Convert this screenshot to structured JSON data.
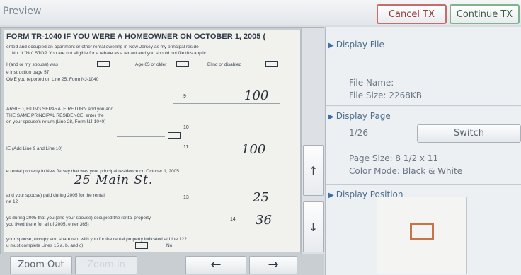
{
  "header": {
    "title": "Preview",
    "cancel_label": "Cancel TX",
    "continue_label": "Continue TX"
  },
  "document": {
    "title": "FORM TR-1040 IF YOU WERE A HOMEOWNER ON OCTOBER 1, 2005 (",
    "lines": [
      "ented and occupied an apartment or other rental dwelling in New Jersey as my principal reside",
      "No. If \"No\" STOP. You are not eligible for a rebate as a tenant and you should not file this applic",
      "I (and or my spouse) was",
      "Age 65 or older",
      "Blind or disabled",
      "e instruction page 57",
      "OME you reported on Line 25, Form NJ-1040",
      "ARRIED, FILING SEPARATE RETURN and you and",
      "THE SAME PRINCIPAL RESIDENCE, enter the",
      "on your spouse's return (Line 28, Form NJ-1040)",
      "IE (Add Line 9 and Line 10)",
      "e rental property in New Jersey that was your principal residence on October 1, 2005.",
      "and your spouse) paid during 2005 for the rental",
      "ne 12",
      "ys during 2005 that you (and your spouse) occupied the rental property",
      "you lived there for all of 2005, enter 365)",
      "your spouse, occupy and share rent with you for the rental property indicated at Line 12?",
      "u must complete Lines 15 a, b, and c)",
      "No"
    ],
    "line_numbers": [
      "9",
      "10",
      "11",
      "13",
      "14"
    ],
    "handwritten": {
      "line9": "100",
      "line11": "100",
      "address": "25 Main St.",
      "line13": "25",
      "line14": "36"
    }
  },
  "scroll": {
    "up_icon": "↑",
    "down_icon": "↓"
  },
  "toolbar": {
    "zoom_out_label": "Zoom Out",
    "zoom_in_label": "Zoom In",
    "prev_icon": "←",
    "next_icon": "→"
  },
  "side": {
    "display_file": {
      "heading": "Display File",
      "file_name": "File Name:",
      "file_size": "File Size: 2268KB"
    },
    "display_page": {
      "heading": "Display Page",
      "page": "1/26",
      "switch_label": "Switch",
      "page_size": "Page Size: 8 1/2 x 11",
      "color_mode": "Color Mode: Black & White"
    },
    "display_position": {
      "heading": "Display Position"
    }
  },
  "colors": {
    "cancel_border": "#c86b6b",
    "continue_border": "#7fb58b",
    "accent": "#3b6ea8",
    "position_marker": "#c8744a"
  }
}
